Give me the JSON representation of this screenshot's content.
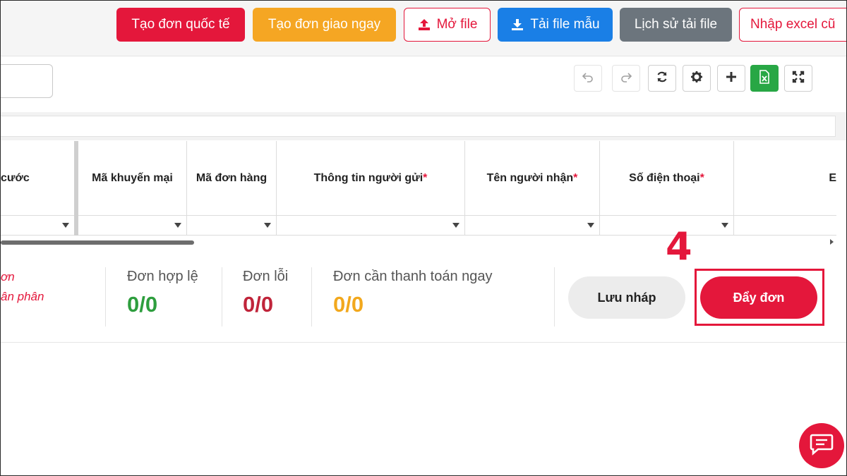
{
  "toolbar": {
    "create_international": "Tạo đơn quốc tế",
    "create_fast_delivery": "Tạo đơn giao ngay",
    "open_file": "Mở file",
    "download_template": "Tải file mẫu",
    "upload_history": "Lịch sử tải file",
    "import_old_excel": "Nhập excel cũ"
  },
  "tools": {
    "icons": [
      "undo-icon",
      "redo-icon",
      "refresh-icon",
      "gear-icon",
      "plus-icon",
      "excel-icon",
      "fullscreen-icon"
    ]
  },
  "grid": {
    "columns": [
      {
        "label": "cước",
        "required": false
      },
      {
        "label": "Mã khuyến mại",
        "required": false
      },
      {
        "label": "Mã đơn hàng",
        "required": false
      },
      {
        "label": "Thông tin người gửi",
        "required": true
      },
      {
        "label": "Tên người nhận",
        "required": true
      },
      {
        "label": "Số điện thoại",
        "required": true
      },
      {
        "label": "E",
        "required": false
      }
    ],
    "required_mark": "*"
  },
  "summary": {
    "note_line1": "ơn",
    "note_line2": "ân phân",
    "valid_label": "Đơn hợp lệ",
    "valid_value": "0/0",
    "error_label": "Đơn lỗi",
    "error_value": "0/0",
    "pay_now_label": "Đơn cần thanh toán ngay",
    "pay_now_value": "0/0"
  },
  "actions": {
    "save_draft": "Lưu nháp",
    "push_order": "Đẩy đơn"
  },
  "annotation": {
    "step_number": "4"
  },
  "colors": {
    "brand_red": "#e4173b",
    "orange": "#f5a623",
    "blue": "#1a7fe6",
    "gray": "#6c757d",
    "green_value": "#2e9e3e",
    "red_value": "#c0243a",
    "orange_value": "#f2a81d"
  }
}
